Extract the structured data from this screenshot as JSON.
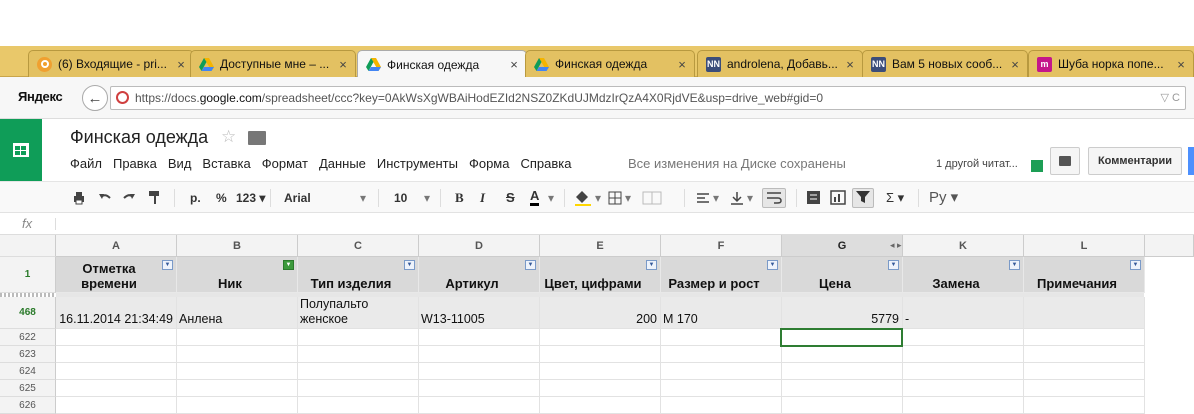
{
  "browser": {
    "tabs": [
      {
        "title": "(6) Входящие - pri...",
        "icon": "mail-icon",
        "color": "#f0a030"
      },
      {
        "title": "Доступные мне – ...",
        "icon": "drive-icon",
        "color": "#2a7fd4"
      },
      {
        "title": "Финская одежда",
        "icon": "drive-icon",
        "color": "#2a7fd4",
        "active": true
      },
      {
        "title": "Финская одежда",
        "icon": "drive-icon",
        "color": "#2a7fd4"
      },
      {
        "title": "androlena, Добавь...",
        "icon": "nn-icon",
        "color": "#3b4d7a",
        "badge": "NN"
      },
      {
        "title": "Вам 5 новых сооб...",
        "icon": "nn-icon",
        "color": "#3b4d7a",
        "badge": "NN"
      },
      {
        "title": "Шуба норка попе...",
        "icon": "m-icon",
        "color": "#c4168a",
        "badge": "m"
      }
    ],
    "tab_close": "×",
    "yandex_logo": "Яндекс",
    "back_glyph": "←",
    "url_prefix": "https://docs.",
    "url_domain": "google.com",
    "url_suffix": "/spreadsheet/ccc?key=0AkWsXgWBAiHodEZId2NSZ0ZKdUJMdzIrQzA4X0RjdVE&usp=drive_web#gid=0",
    "url_icons": "▽ C"
  },
  "doc": {
    "title": "Финская одежда",
    "star_glyph": "☆",
    "menus": [
      "Файл",
      "Правка",
      "Вид",
      "Вставка",
      "Формат",
      "Данные",
      "Инструменты",
      "Форма",
      "Справка"
    ],
    "saved_status": "Все изменения на Диске сохранены",
    "collaborators": "1 другой читат...",
    "comments_label": "Комментарии"
  },
  "toolbar": {
    "currency": "р.",
    "percent": "%",
    "number_format": "123 ▾",
    "font": "Arial",
    "font_size": "10",
    "bold": "B",
    "italic": "I",
    "strike": "S",
    "text_color": "A",
    "sum": "Σ ▾",
    "input_tools": "Ру ▾"
  },
  "formula_bar": {
    "label": "fx"
  },
  "sheet": {
    "columns": [
      "A",
      "B",
      "C",
      "D",
      "E",
      "F",
      "G",
      "K",
      "L"
    ],
    "header_row_number": "1",
    "headers": [
      "Отметка времени",
      "Ник",
      "Тип изделия",
      "Артикул",
      "Цвет, цифрами",
      "Размер и рост",
      "Цена",
      "Замена",
      "Примечания"
    ],
    "data_row": {
      "row_number": "468",
      "cells": [
        "16.11.2014 21:34:49",
        "Анлена",
        "Полупальто женское",
        "W13-11005",
        "200",
        "M 170",
        "5779",
        "-",
        ""
      ]
    },
    "empty_rows": [
      "622",
      "623",
      "624",
      "625",
      "626"
    ]
  },
  "colors": {
    "tabbar": "#e9c86a",
    "sheets_green": "#0f9d58",
    "header_fill": "#d9d9d9",
    "selection": "#2e7d32"
  }
}
